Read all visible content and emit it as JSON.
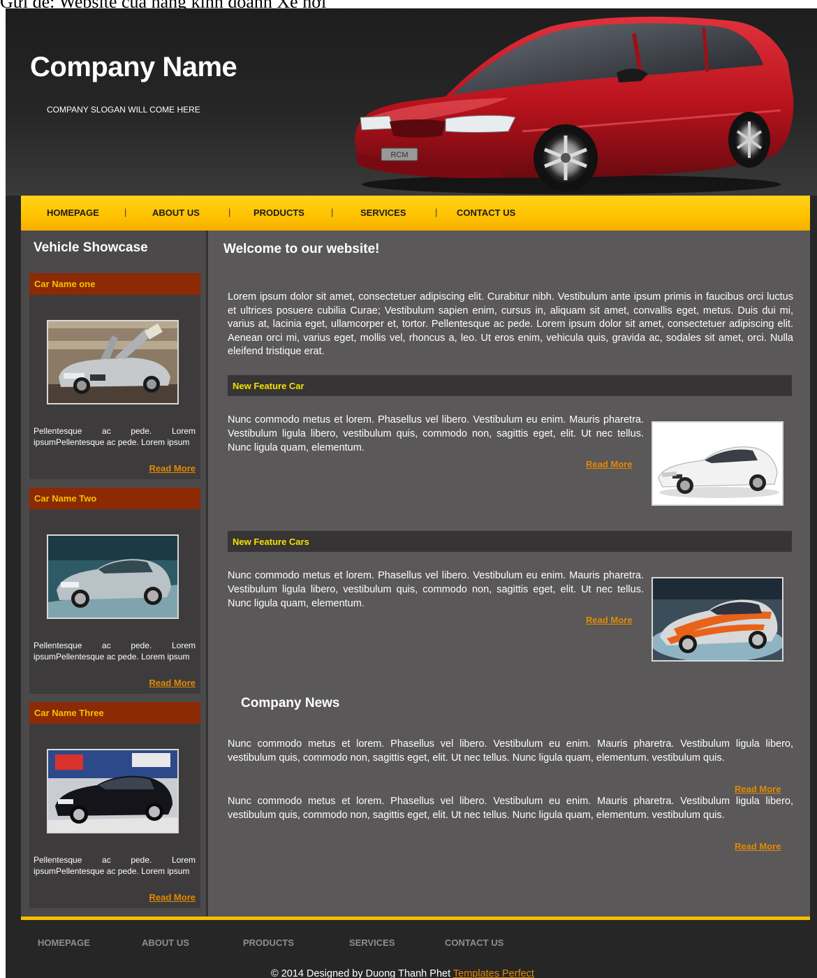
{
  "document": {
    "caption": "Gửi đề: Website của hãng kinh doanh Xe hơi"
  },
  "header": {
    "company_name": "Company Name",
    "slogan": "COMPANY SLOGAN WILL COME HERE",
    "car_plate": "RCM"
  },
  "nav": {
    "items": [
      {
        "label": "HOMEPAGE"
      },
      {
        "label": "ABOUT US"
      },
      {
        "label": "PRODUCTS"
      },
      {
        "label": "SERVICES"
      },
      {
        "label": "CONTACT US"
      }
    ],
    "separator": "|"
  },
  "sidebar": {
    "title": "Vehicle Showcase",
    "cards": [
      {
        "title": "Car Name one",
        "text": "Pellentesque ac pede. Lorem ipsumPellentesque ac pede. Lorem ipsum",
        "more": "Read More"
      },
      {
        "title": "Car Name Two",
        "text": "Pellentesque ac pede. Lorem ipsumPellentesque ac pede. Lorem ipsum",
        "more": "Read More"
      },
      {
        "title": "Car Name Three",
        "text": "Pellentesque ac pede. Lorem ipsumPellentesque ac pede. Lorem ipsum",
        "more": "Read More"
      }
    ]
  },
  "main": {
    "welcome_title": "Welcome to our website!",
    "intro": "Lorem ipsum dolor sit amet, consectetuer adipiscing elit. Curabitur nibh. Vestibulum ante ipsum primis in faucibus orci luctus et ultrices posuere cubilia Curae; Vestibulum sapien enim, cursus in, aliquam sit amet, convallis eget, metus. Duis dui mi, varius at, lacinia eget, ullamcorper et, tortor. Pellentesque ac pede. Lorem ipsum dolor sit amet, consectetuer adipiscing elit. Aenean orci mi, varius eget, mollis vel, rhoncus a, leo. Ut eros enim, vehicula quis, gravida ac, sodales sit amet, orci. Nulla eleifend tristique erat.",
    "features": [
      {
        "title": "New Feature Car",
        "text": "Nunc commodo metus et lorem. Phasellus vel libero. Vestibulum eu enim. Mauris pharetra. Vestibulum ligula libero, vestibulum quis, commodo non, sagittis eget, elit. Ut nec tellus. Nunc ligula quam, elementum.",
        "more": "Read More"
      },
      {
        "title": "New Feature Cars",
        "text": "Nunc commodo metus et lorem. Phasellus vel libero. Vestibulum eu enim. Mauris pharetra. Vestibulum ligula libero, vestibulum quis, commodo non, sagittis eget, elit. Ut nec tellus. Nunc ligula quam, elementum.",
        "more": "Read More"
      }
    ],
    "news_title": "Company News",
    "news": [
      {
        "text": "Nunc commodo metus et lorem. Phasellus vel libero. Vestibulum eu enim. Mauris pharetra. Vestibulum ligula libero, vestibulum quis, commodo non, sagittis eget, elit. Ut nec tellus. Nunc ligula quam, elementum. vestibulum quis.",
        "more": "Read More"
      },
      {
        "text": "Nunc commodo metus et lorem. Phasellus vel libero. Vestibulum eu enim. Mauris pharetra. Vestibulum ligula libero, vestibulum quis, commodo non, sagittis eget, elit. Ut nec tellus. Nunc ligula quam, elementum. vestibulum quis.",
        "more": "Read More"
      }
    ]
  },
  "footer": {
    "nav": [
      {
        "label": "HOMEPAGE"
      },
      {
        "label": "ABOUT US"
      },
      {
        "label": "PRODUCTS"
      },
      {
        "label": "SERVICES"
      },
      {
        "label": "CONTACT US"
      }
    ],
    "copyright": "© 2014 Designed by Duong Thanh Phet",
    "link": "Templates Perfect"
  },
  "colors": {
    "background": "#262626",
    "content": "#5a5859",
    "sidebar": "#4b494a",
    "nav_yellow": "#ffc200",
    "card_header": "#8b2a04",
    "card_title": "#f5c000",
    "feature_title": "#f5e000",
    "link_orange": "#e28a00"
  }
}
